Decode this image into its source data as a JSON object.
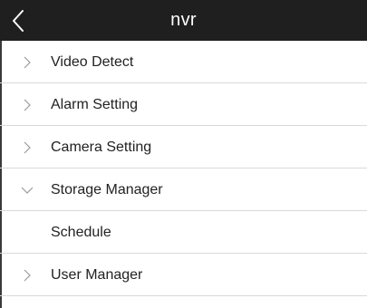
{
  "header": {
    "title": "nvr",
    "back_icon": "chevron-left-icon"
  },
  "colors": {
    "header_bg": "#1f1f1f",
    "header_text": "#ffffff",
    "divider": "#d9d9d9",
    "chevron": "#9a9a9a",
    "label": "#222222"
  },
  "menu": {
    "items": [
      {
        "label": "Video Detect",
        "icon": "chevron-right-icon",
        "expanded": false
      },
      {
        "label": "Alarm Setting",
        "icon": "chevron-right-icon",
        "expanded": false
      },
      {
        "label": "Camera Setting",
        "icon": "chevron-right-icon",
        "expanded": false
      },
      {
        "label": "Storage Manager",
        "icon": "chevron-down-icon",
        "expanded": true
      },
      {
        "label": "Schedule",
        "icon": "",
        "sub_item": true
      },
      {
        "label": "User Manager",
        "icon": "chevron-right-icon",
        "expanded": false
      }
    ]
  }
}
